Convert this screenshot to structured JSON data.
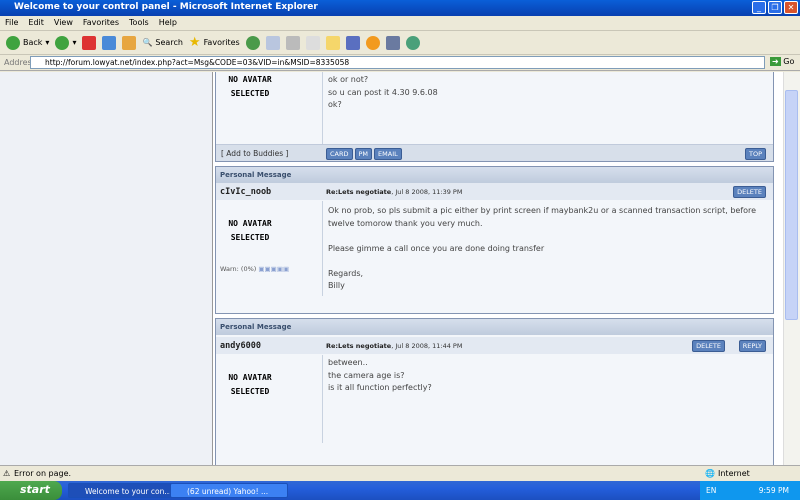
{
  "window": {
    "title": "Welcome to your control panel - Microsoft Internet Explorer"
  },
  "menu": [
    "File",
    "Edit",
    "View",
    "Favorites",
    "Tools",
    "Help"
  ],
  "toolbar": {
    "back": "Back",
    "search": "Search",
    "favorites": "Favorites"
  },
  "address": {
    "label": "Address",
    "url": "http://forum.lowyat.net/index.php?act=Msg&CODE=03&VID=in&MSID=8335058",
    "go": "Go"
  },
  "common": {
    "no_avatar_1": "NO AVATAR",
    "no_avatar_2": "SELECTED",
    "add_buddies": "[ Add to Buddies ]",
    "card": "CARD",
    "pm": "PM",
    "email": "EMAIL",
    "top": "TOP",
    "delete": "DELETE",
    "reply": "REPLY",
    "section": "Personal Message"
  },
  "messages": [
    {
      "lines": [
        "ok or not?",
        "so u can post it 4.30 9.6.08",
        "ok?"
      ]
    },
    {
      "author": "cIvIc_noob",
      "subject": "Re:Lets negotiate",
      "date": ", Jul 8 2008, 11:39 PM",
      "lines": [
        "Ok no prob, so pls submit a pic either by print screen if maybank2u or a scanned transaction script, before",
        "twelve tomorow thank you very much.",
        "",
        "Please gimme a call once you are done doing transfer",
        "",
        "Regards,",
        "Billy"
      ],
      "warn": "Warn: (0%)"
    },
    {
      "author": "andy6000",
      "subject": "Re:Lets negotiate",
      "date": ", Jul 8 2008, 11:44 PM",
      "lines": [
        "between..",
        "the camera age is?",
        "is it all function perfectly?"
      ]
    }
  ],
  "status": {
    "text": "Error on page.",
    "zone": "Internet"
  },
  "taskbar": {
    "start": "start",
    "tasks": [
      "Welcome to your con...",
      "(62 unread) Yahoo! ..."
    ],
    "lang": "EN",
    "clock": "9:59 PM"
  }
}
